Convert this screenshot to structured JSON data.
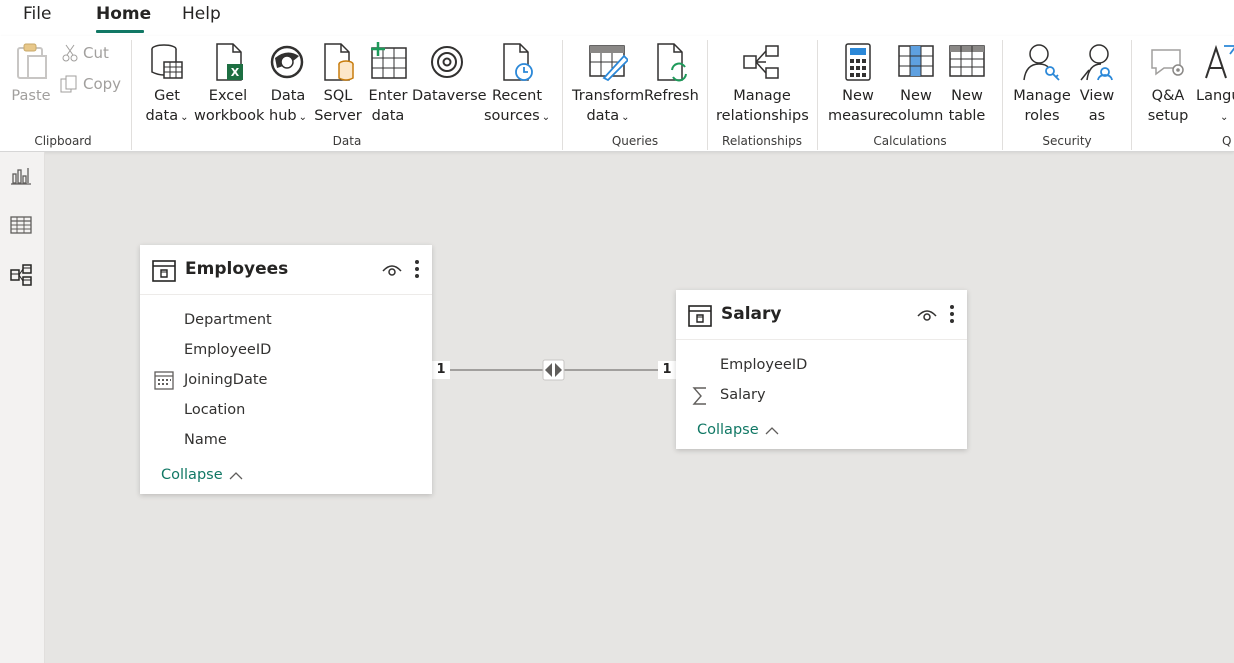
{
  "menu": {
    "file": "File",
    "home": "Home",
    "help": "Help"
  },
  "ribbon": {
    "clipboard": {
      "paste": "Paste",
      "cut": "Cut",
      "copy": "Copy",
      "label": "Clipboard"
    },
    "data": {
      "get_data": [
        "Get",
        "data"
      ],
      "excel": [
        "Excel",
        "workbook"
      ],
      "data_hub": [
        "Data",
        "hub"
      ],
      "sql": [
        "SQL",
        "Server"
      ],
      "enter": [
        "Enter",
        "data"
      ],
      "dataverse": "Dataverse",
      "recent": [
        "Recent",
        "sources"
      ],
      "label": "Data"
    },
    "queries": {
      "transform": [
        "Transform",
        "data"
      ],
      "refresh": "Refresh",
      "label": "Queries"
    },
    "relationships": {
      "manage": [
        "Manage",
        "relationships"
      ],
      "label": "Relationships"
    },
    "calculations": {
      "new_measure": [
        "New",
        "measure"
      ],
      "new_column": [
        "New",
        "column"
      ],
      "new_table": [
        "New",
        "table"
      ],
      "label": "Calculations"
    },
    "security": {
      "manage_roles": [
        "Manage",
        "roles"
      ],
      "view_as": [
        "View",
        "as"
      ],
      "label": "Security"
    },
    "qa": {
      "qa_setup": [
        "Q&A",
        "setup"
      ],
      "language": "Langu",
      "label": "Q"
    }
  },
  "tables": {
    "employees": {
      "title": "Employees",
      "fields": [
        "Department",
        "EmployeeID",
        "JoiningDate",
        "Location",
        "Name"
      ],
      "collapse": "Collapse"
    },
    "salary": {
      "title": "Salary",
      "fields": [
        "EmployeeID",
        "Salary"
      ],
      "collapse": "Collapse"
    }
  },
  "relationship": {
    "left_cardinality": "1",
    "right_cardinality": "1",
    "filter_direction": "both"
  },
  "colors": {
    "accent": "#117865",
    "canvas": "#e6e5e3",
    "excel_green": "#1d6f42"
  }
}
